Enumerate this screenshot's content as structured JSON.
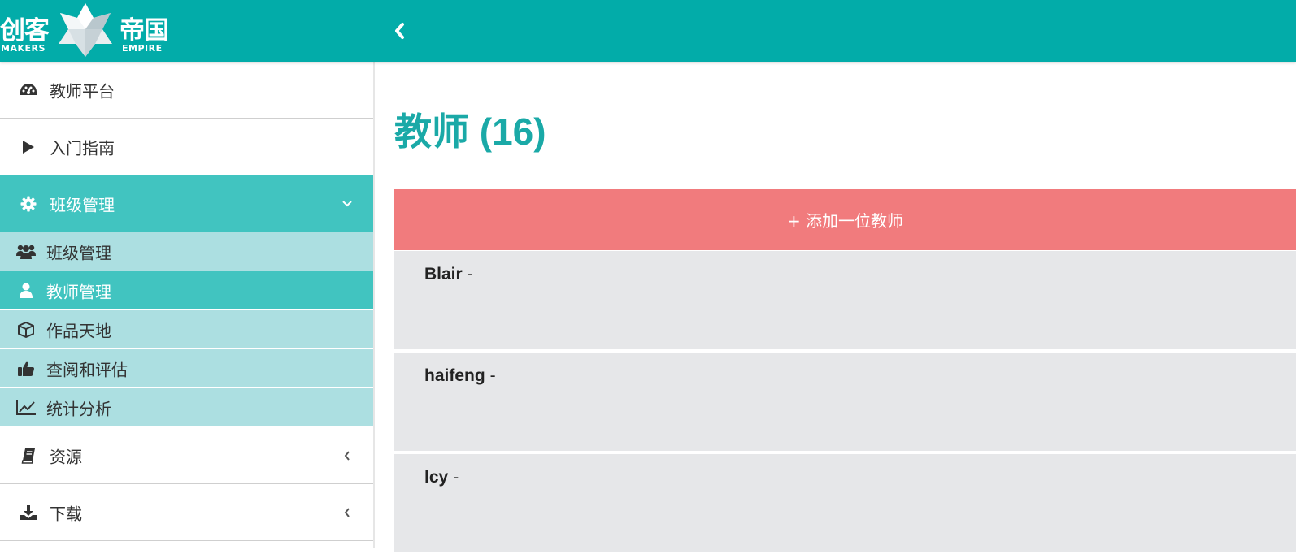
{
  "brand": {
    "cn_left": "创客",
    "cn_right": "帝国",
    "en_left": "MAKERS",
    "en_right": "EMPIRE"
  },
  "sidebar": {
    "items": [
      {
        "label": "教师平台",
        "icon": "dashboard-icon"
      },
      {
        "label": "入门指南",
        "icon": "play-icon"
      },
      {
        "label": "班级管理",
        "icon": "gear-icon",
        "expanded": true
      }
    ],
    "sub_items": [
      {
        "label": "班级管理",
        "icon": "users-icon"
      },
      {
        "label": "教师管理",
        "icon": "user-icon",
        "active": true
      },
      {
        "label": "作品天地",
        "icon": "cube-icon"
      },
      {
        "label": "查阅和评估",
        "icon": "thumbs-up-icon"
      },
      {
        "label": "统计分析",
        "icon": "line-chart-icon"
      }
    ],
    "bottom_items": [
      {
        "label": "资源",
        "icon": "book-icon"
      },
      {
        "label": "下载",
        "icon": "download-icon"
      }
    ]
  },
  "main": {
    "title": "教师 (16)",
    "add_button": "+ 添加一位教师",
    "teachers": [
      {
        "name": "Blair",
        "suffix": "-"
      },
      {
        "name": "haifeng",
        "suffix": "-"
      },
      {
        "name": "lcy",
        "suffix": "-"
      }
    ]
  },
  "colors": {
    "topbar": "#02aca9",
    "active": "#41c4c0",
    "submenu": "#acdfe1",
    "add_button": "#f17b7d",
    "title": "#1aa9a7",
    "row": "#e6e7e9"
  }
}
